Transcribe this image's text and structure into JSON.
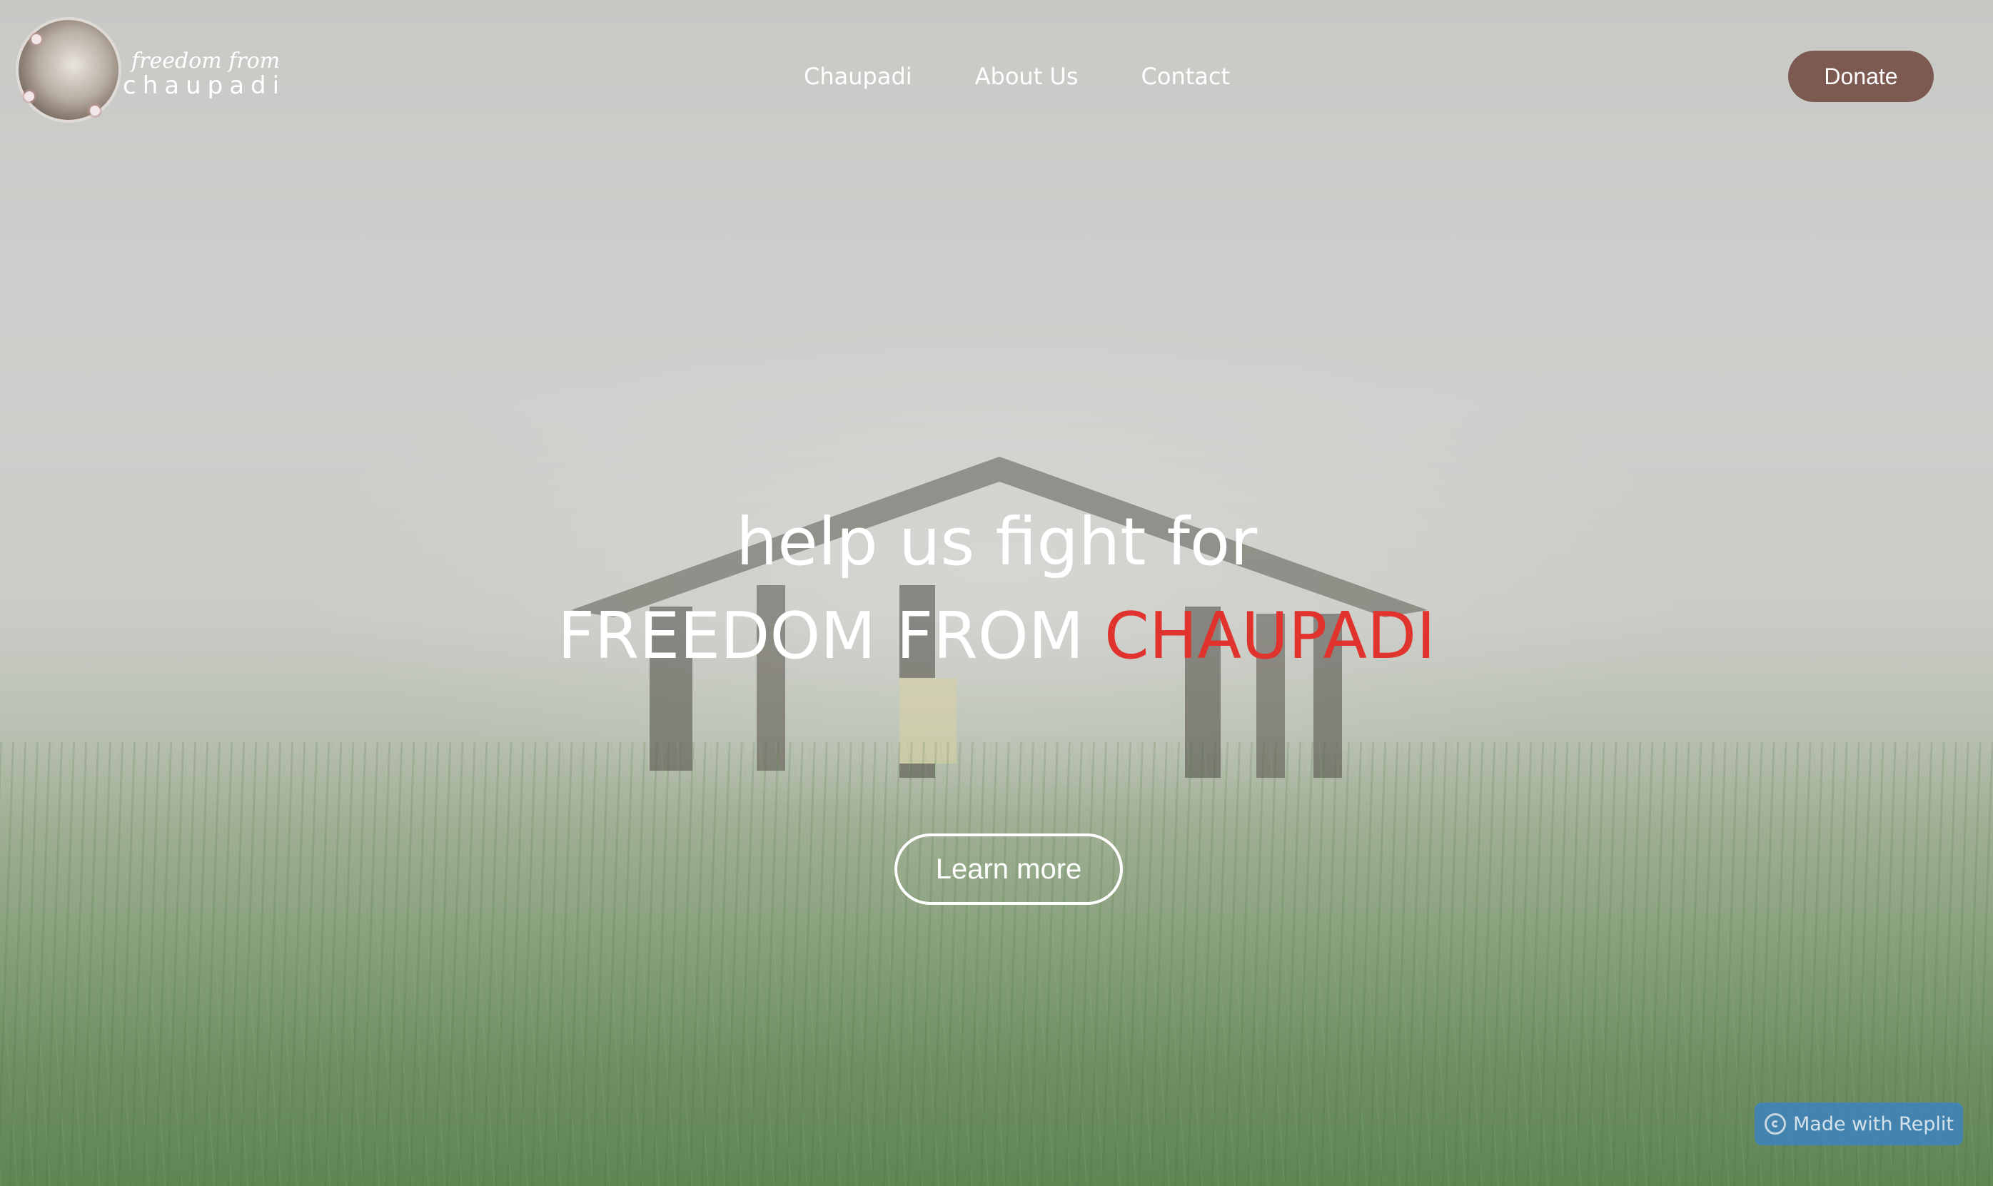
{
  "logo": {
    "line1": "freedom from",
    "line2": "chaupadi"
  },
  "nav": {
    "items": [
      {
        "label": "Chaupadi"
      },
      {
        "label": "About Us"
      },
      {
        "label": "Contact"
      }
    ]
  },
  "header": {
    "donate_label": "Donate"
  },
  "hero": {
    "headline_line1": "help us fight for",
    "headline_line2_prefix": "FREEDOM FROM ",
    "headline_line2_accent": "CHAUPADI",
    "cta_label": "Learn more"
  },
  "badge": {
    "label": "Made with Replit",
    "icon": "replit-icon"
  },
  "colors": {
    "donate_bg": "#7c5a52",
    "accent_red": "#e0332d",
    "badge_bg": "#3a82c8"
  }
}
